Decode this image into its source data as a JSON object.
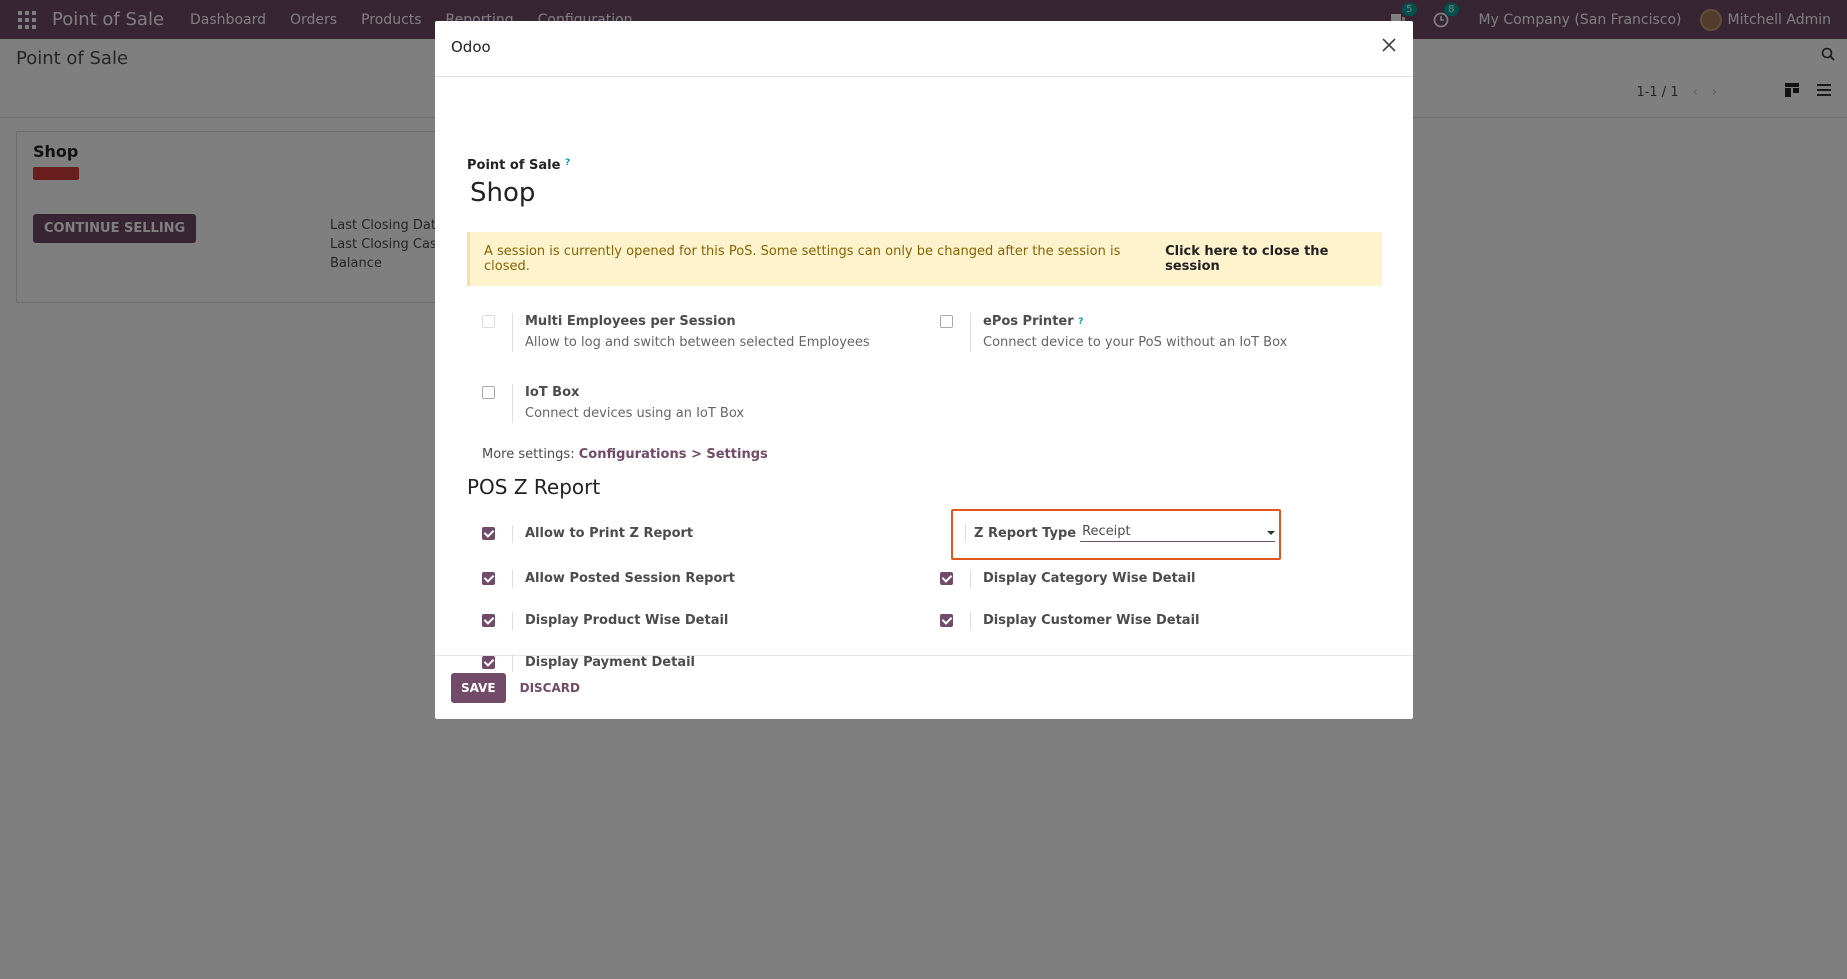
{
  "navbar": {
    "brand": "Point of Sale",
    "menu": [
      "Dashboard",
      "Orders",
      "Products",
      "Reporting",
      "Configuration"
    ],
    "messages_count": "5",
    "activities_count": "8",
    "company": "My Company (San Francisco)",
    "user": "Mitchell Admin"
  },
  "control_panel": {
    "breadcrumb": "Point of Sale",
    "pager": "1-1 / 1"
  },
  "kanban": {
    "title": "Shop",
    "continue_label": "CONTINUE SELLING",
    "info": [
      "Last Closing Date",
      "Last Closing Cash",
      "Balance"
    ]
  },
  "modal": {
    "title": "Odoo",
    "field_label": "Point of Sale",
    "help_mark": "?",
    "name": "Shop",
    "alert_text": "A session is currently opened for this PoS. Some settings can only be changed after the session is closed.",
    "alert_link": "Click here to close the session",
    "settings": {
      "multi_employees": {
        "title": "Multi Employees per Session",
        "desc": "Allow to log and switch between selected Employees",
        "checked": false
      },
      "epos_printer": {
        "title": "ePos Printer",
        "desc": "Connect device to your PoS without an IoT Box",
        "checked": false
      },
      "iot_box": {
        "title": "IoT Box",
        "desc": "Connect devices using an IoT Box",
        "checked": false
      }
    },
    "more_settings_prefix": "More settings:",
    "more_settings_link": "Configurations > Settings",
    "section_title": "POS Z Report",
    "zreport": {
      "allow_print": "Allow to Print Z Report",
      "allow_posted": "Allow Posted Session Report",
      "product_wise": "Display Product Wise Detail",
      "payment_detail": "Display Payment Detail",
      "category_wise": "Display Category Wise Detail",
      "customer_wise": "Display Customer Wise Detail",
      "type_label": "Z Report Type",
      "type_value": "Receipt"
    },
    "save_label": "SAVE",
    "discard_label": "DISCARD"
  },
  "colors": {
    "primary": "#714b67",
    "highlight": "#e0561f",
    "alert_bg": "#fff3cd"
  }
}
